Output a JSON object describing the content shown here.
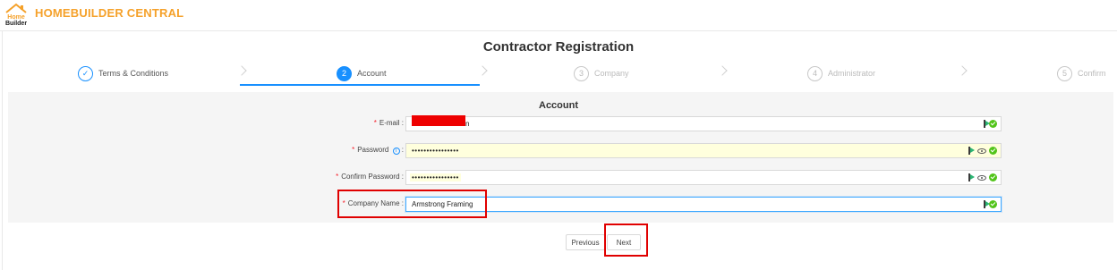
{
  "app": {
    "logo_text_top": "Home",
    "logo_text_bottom": "Builder",
    "brand": "HOMEBUILDER CENTRAL",
    "brand_color": "#f5a12a"
  },
  "page_title": "Contractor Registration",
  "steps": [
    {
      "number": "✓",
      "label": "Terms & Conditions",
      "status": "done"
    },
    {
      "number": "2",
      "label": "Account",
      "status": "active"
    },
    {
      "number": "3",
      "label": "Company",
      "status": "wait"
    },
    {
      "number": "4",
      "label": "Administrator",
      "status": "wait"
    },
    {
      "number": "5",
      "label": "Confirm",
      "status": "wait"
    }
  ],
  "form": {
    "title": "Account",
    "email": {
      "label": "E-mail",
      "value": "n",
      "redacted": true
    },
    "password": {
      "label": "Password",
      "value": "••••••••••••••••",
      "info_icon": "info-icon"
    },
    "confirm_password": {
      "label": "Confirm Password",
      "value": "••••••••••••••••"
    },
    "company_name": {
      "label": "Company Name",
      "value": "Armstrong Framing"
    }
  },
  "buttons": {
    "previous": "Previous",
    "next": "Next"
  },
  "colors": {
    "primary": "#1890ff",
    "required": "#f5222d",
    "autofill_bg": "#ffffdd",
    "annotation": "#e00000"
  }
}
